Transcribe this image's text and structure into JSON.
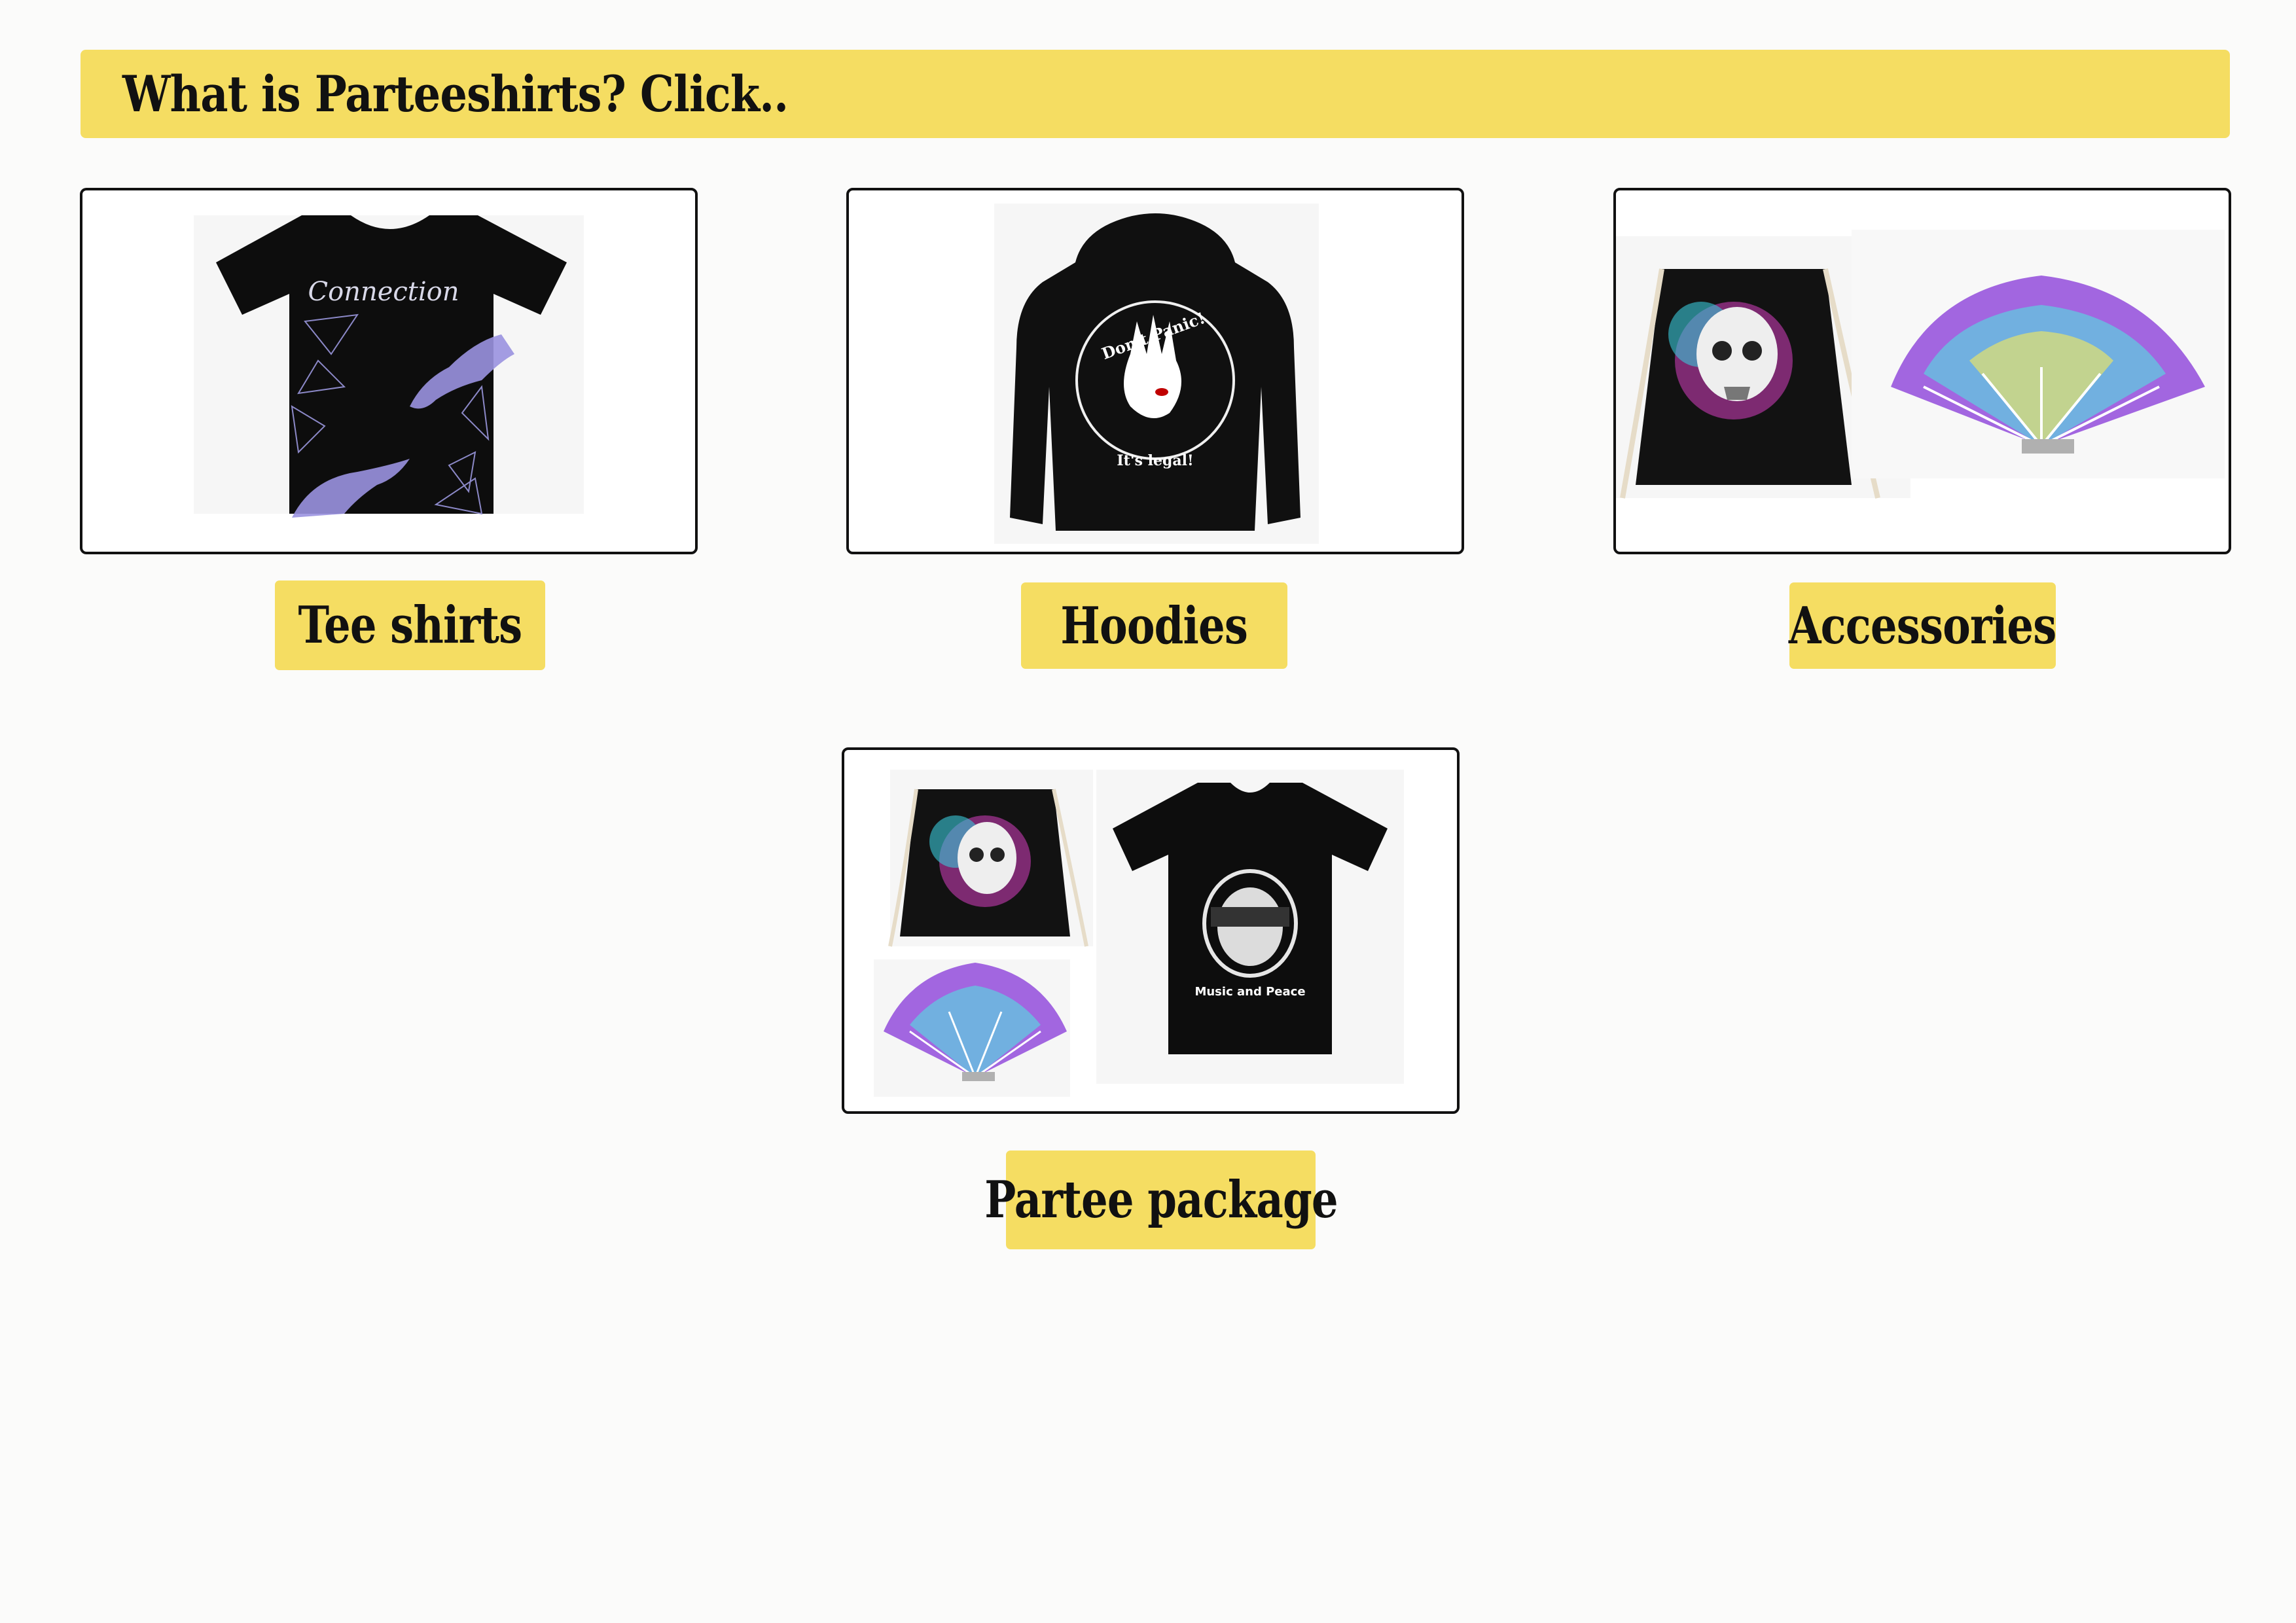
{
  "banner": {
    "text": "What is Parteeshirts?  Click.."
  },
  "categories": [
    {
      "label": "Tee shirts",
      "image_text": "Connection"
    },
    {
      "label": "Hoodies",
      "image_text_top": "Don't Panic!",
      "image_text_bottom": "It's legal!"
    },
    {
      "label": "Accessories"
    },
    {
      "label": "Partee package",
      "image_text": "Music and Peace"
    }
  ],
  "colors": {
    "accent": "#f5dd62",
    "background": "#fbfbfa",
    "border": "#111111"
  }
}
